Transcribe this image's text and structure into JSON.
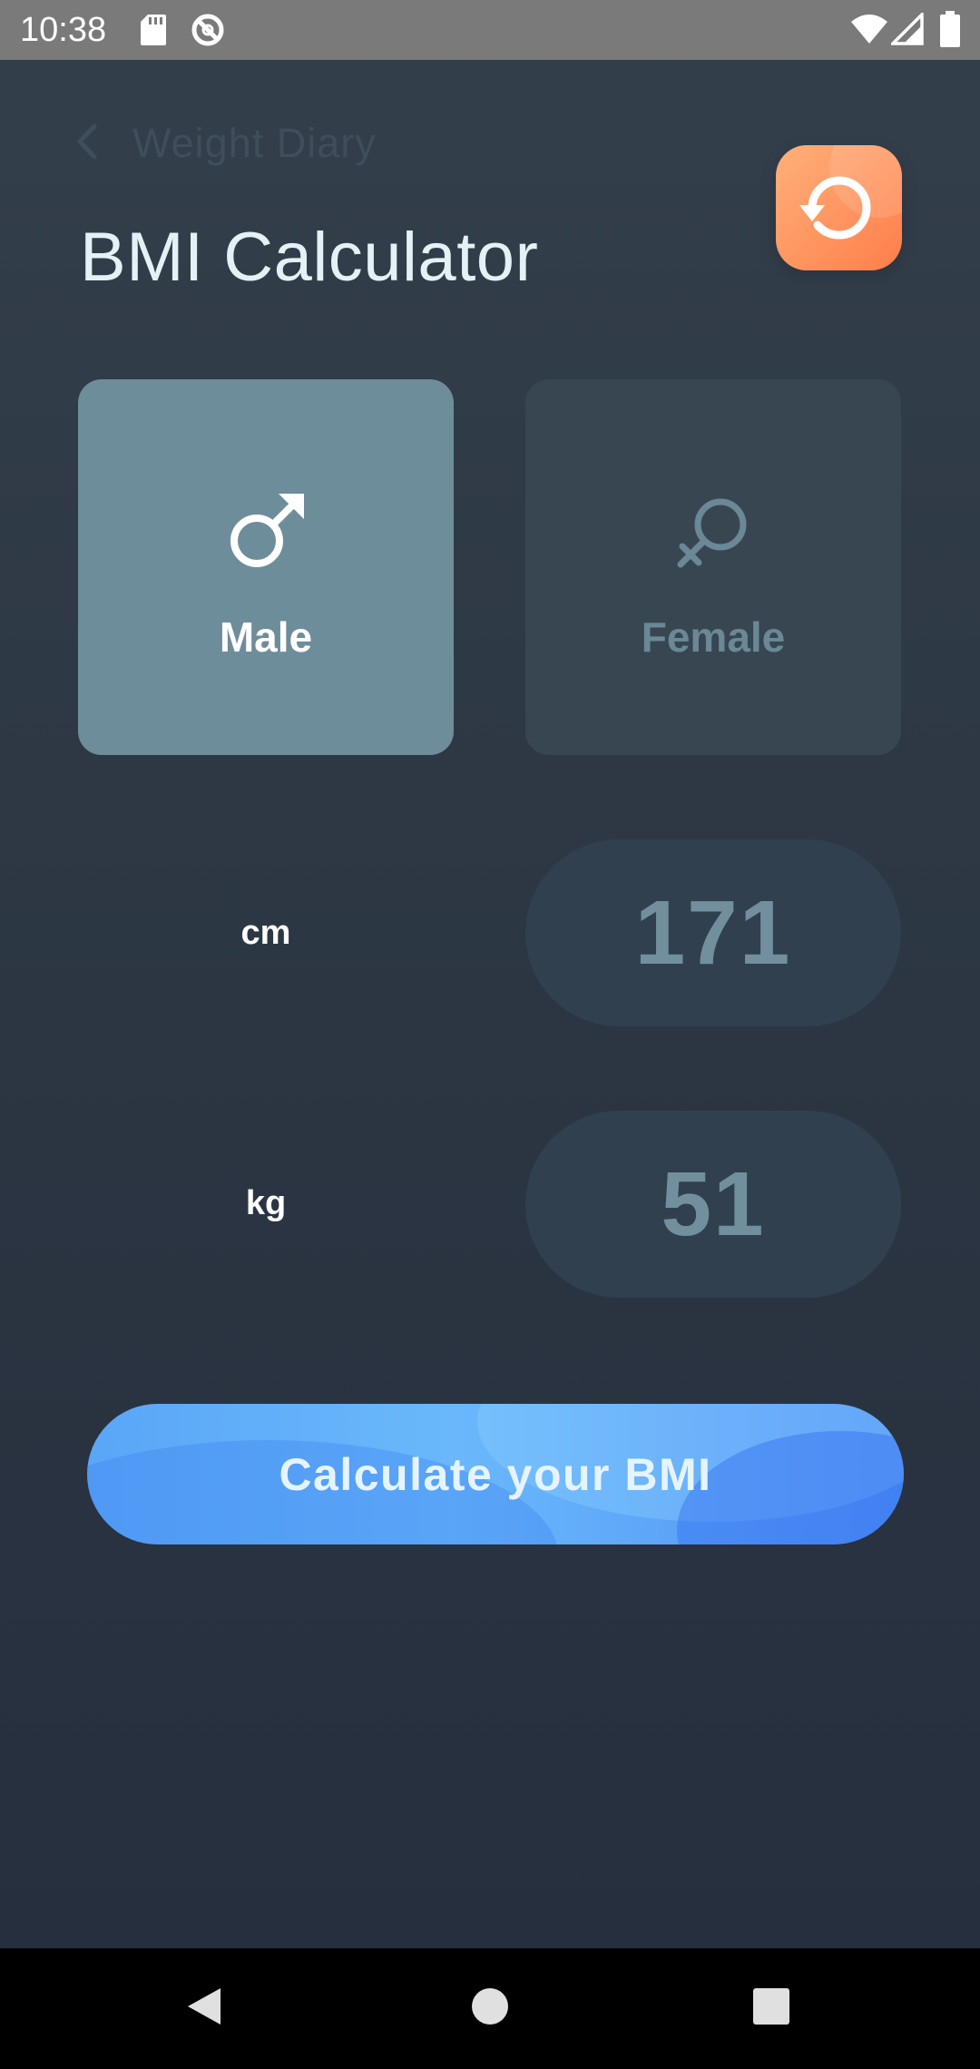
{
  "status_bar": {
    "time": "10:38",
    "icons": [
      "sd-card-icon",
      "do-not-disturb-icon",
      "wifi-icon",
      "signal-icon",
      "battery-icon"
    ]
  },
  "header": {
    "back_label": "Weight Diary",
    "title": "BMI Calculator",
    "reset_icon": "reset-icon"
  },
  "gender": {
    "selected": "Male",
    "options": [
      {
        "label": "Male",
        "icon": "male-symbol-icon"
      },
      {
        "label": "Female",
        "icon": "female-symbol-icon"
      }
    ]
  },
  "measurements": {
    "height": {
      "unit": "cm",
      "value": "171"
    },
    "weight": {
      "unit": "kg",
      "value": "51"
    }
  },
  "actions": {
    "calculate_label": "Calculate your BMI"
  },
  "nav_bar": {
    "buttons": [
      "back-triangle-icon",
      "home-circle-icon",
      "recents-square-icon"
    ]
  },
  "colors": {
    "background_top": "#333f4b",
    "background_bottom": "#252e3d",
    "selected_card": "#6e8d9b",
    "unselected_card": "#384652",
    "value_pill": "#30404f",
    "reset_accent": "#ff7e4a",
    "calculate_accent": "#5aa6f7"
  }
}
